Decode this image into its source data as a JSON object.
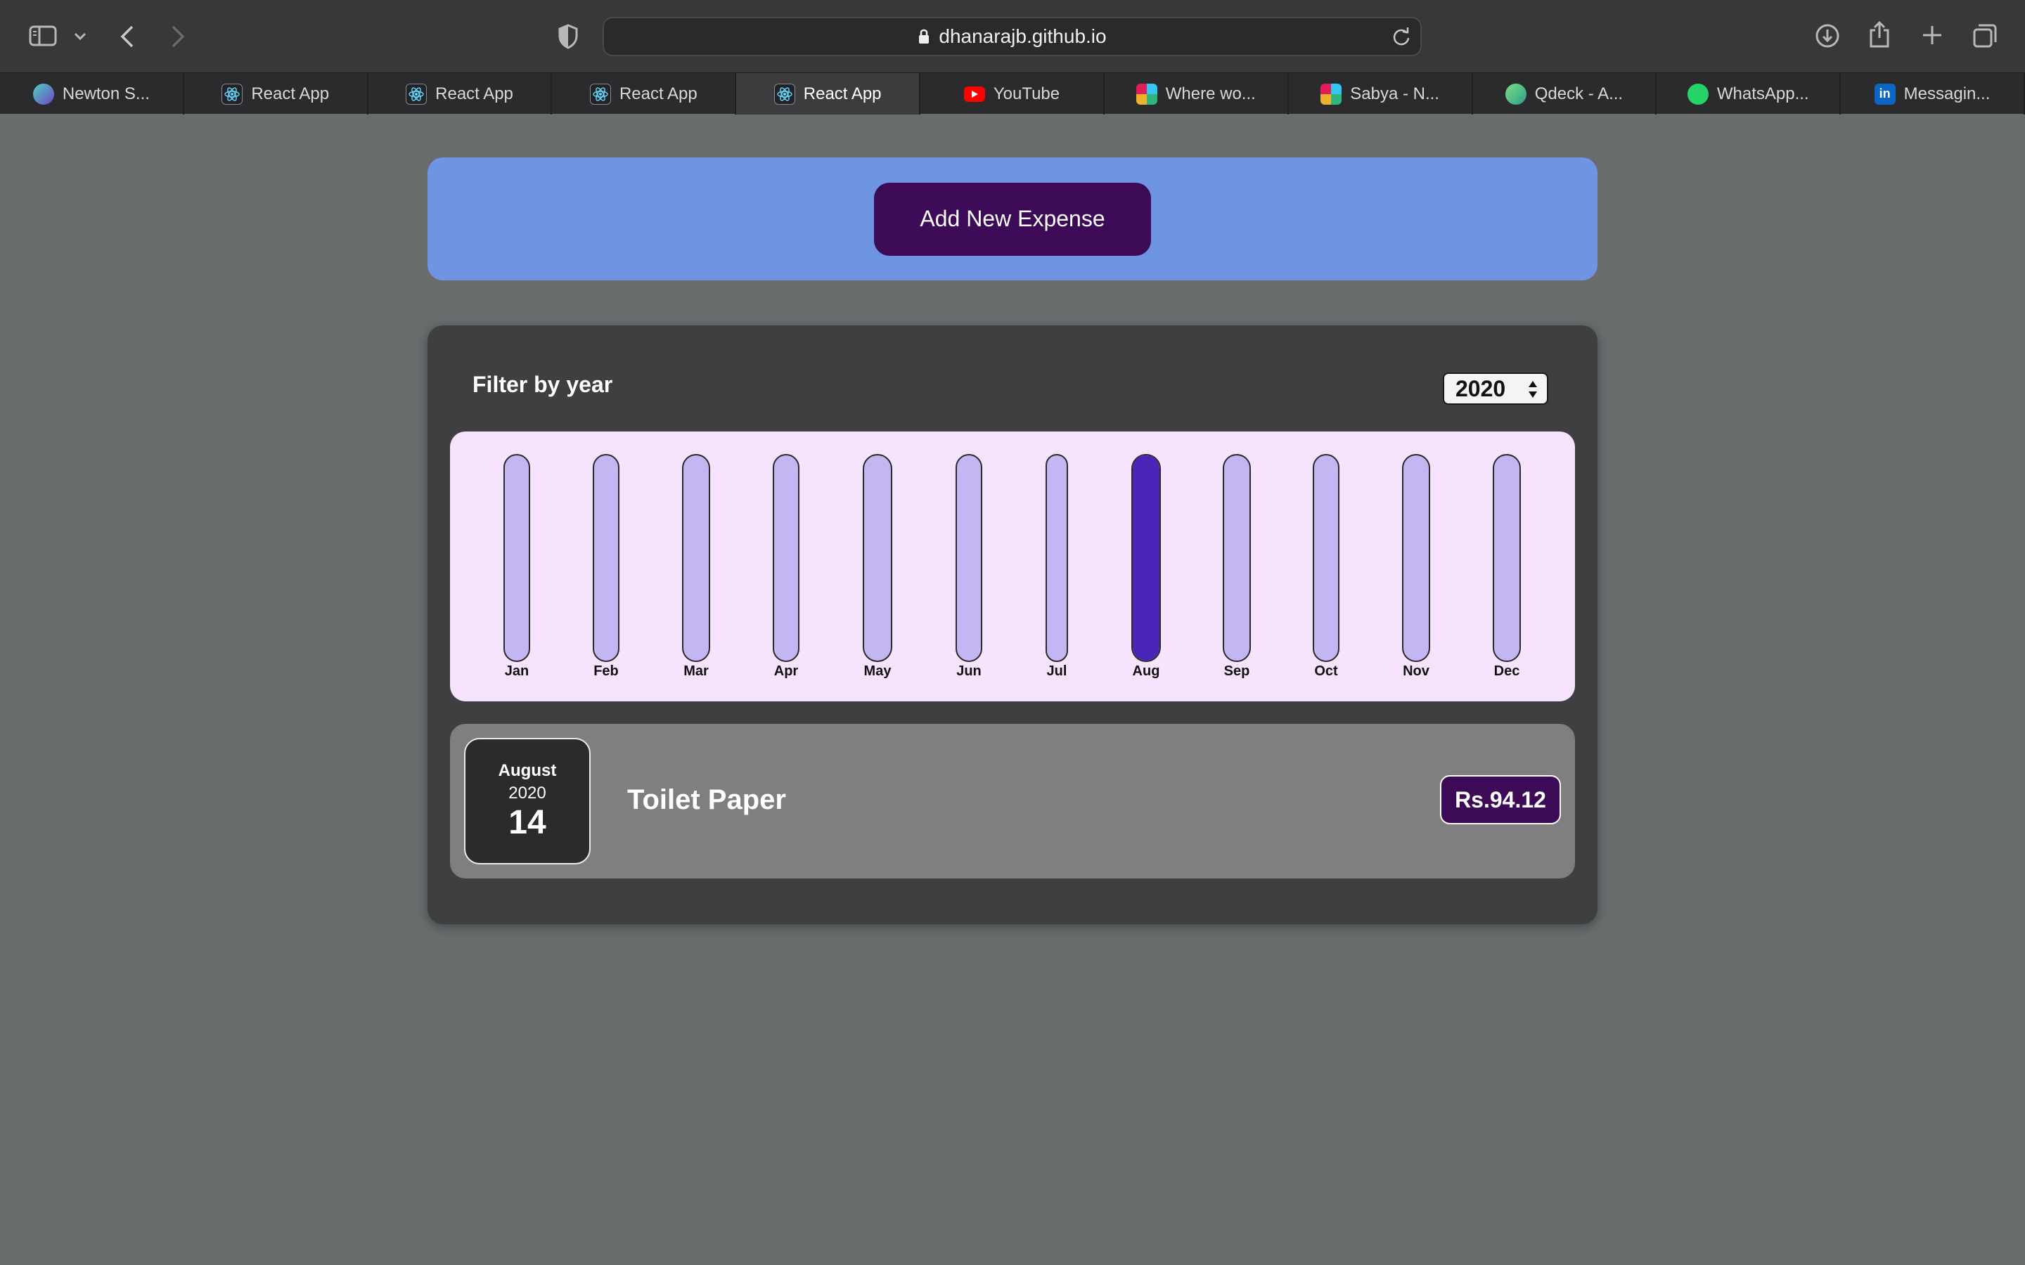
{
  "browser": {
    "url": "dhanarajb.github.io",
    "tabs": [
      {
        "label": "Newton S...",
        "icon": "newton-icon"
      },
      {
        "label": "React App",
        "icon": "react-icon"
      },
      {
        "label": "React App",
        "icon": "react-icon"
      },
      {
        "label": "React App",
        "icon": "react-icon"
      },
      {
        "label": "React App",
        "icon": "react-icon",
        "active": true
      },
      {
        "label": "YouTube",
        "icon": "youtube-icon"
      },
      {
        "label": "Where wo...",
        "icon": "slack-icon"
      },
      {
        "label": "Sabya - N...",
        "icon": "slack-icon"
      },
      {
        "label": "Qdeck - A...",
        "icon": "qdeck-icon"
      },
      {
        "label": "WhatsApp...",
        "icon": "whatsapp-icon"
      },
      {
        "label": "Messagin...",
        "icon": "linkedin-icon"
      }
    ]
  },
  "new_expense": {
    "button_label": "Add New Expense"
  },
  "filter": {
    "label": "Filter by year",
    "selected_year": "2020"
  },
  "chart_data": {
    "type": "bar",
    "categories": [
      "Jan",
      "Feb",
      "Mar",
      "Apr",
      "May",
      "Jun",
      "Jul",
      "Aug",
      "Sep",
      "Oct",
      "Nov",
      "Dec"
    ],
    "values": [
      0,
      0,
      0,
      0,
      0,
      0,
      0,
      94.12,
      0,
      0,
      0,
      0
    ],
    "max": 94.12
  },
  "expenses": [
    {
      "month": "August",
      "year": "2020",
      "day": "14",
      "title": "Toilet Paper",
      "amount": "Rs.94.12"
    }
  ],
  "colors": {
    "page_bg": "#686c6d",
    "header_bg": "#6f94e3",
    "button_bg": "#3d0a58",
    "panel_bg": "#3e3f41",
    "chart_bg": "#f6e3fd",
    "bar_track": "#c4b5f3",
    "bar_fill": "#4a26b8",
    "item_bg": "#7f7f7f"
  }
}
